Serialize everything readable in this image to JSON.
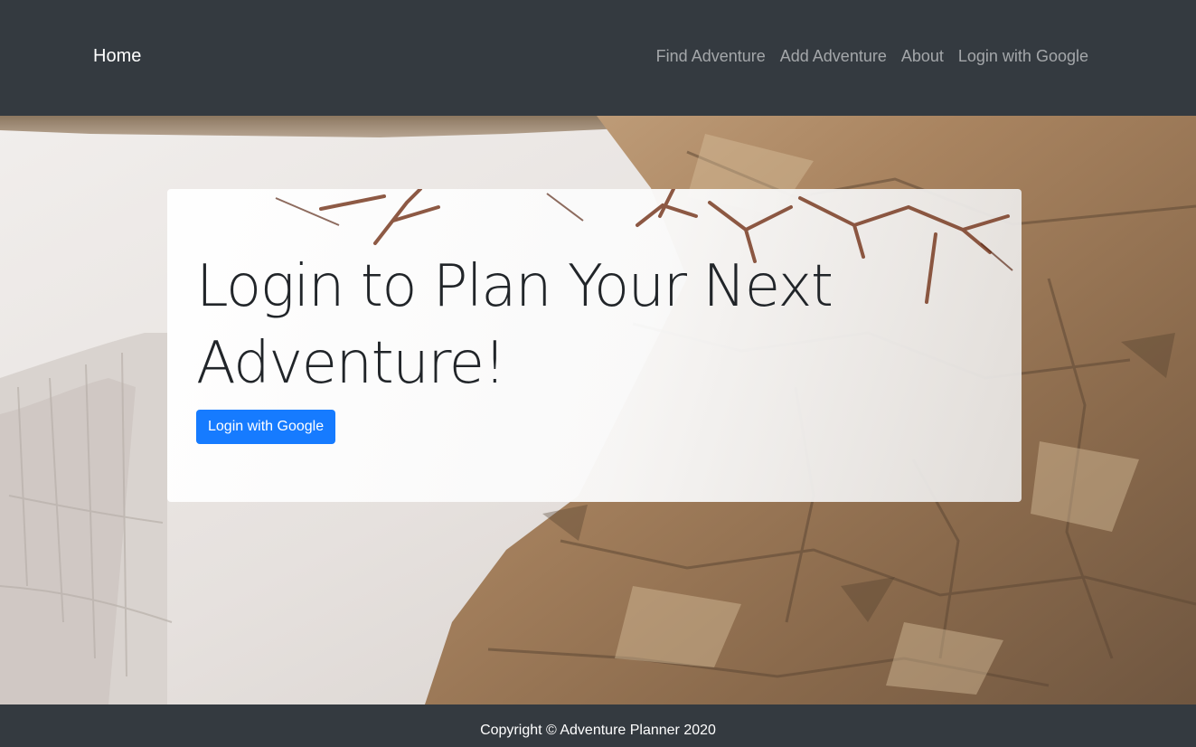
{
  "navbar": {
    "brand": "Home",
    "links": [
      "Find Adventure",
      "Add Adventure",
      "About",
      "Login with Google"
    ]
  },
  "hero": {
    "title": "Login to Plan Your Next Adventure!",
    "button_label": "Login with Google"
  },
  "footer": {
    "copyright": "Copyright © Adventure Planner 2020"
  },
  "colors": {
    "navbar_bg": "#343a40",
    "primary_button": "#167bff",
    "title_text": "#212529"
  }
}
